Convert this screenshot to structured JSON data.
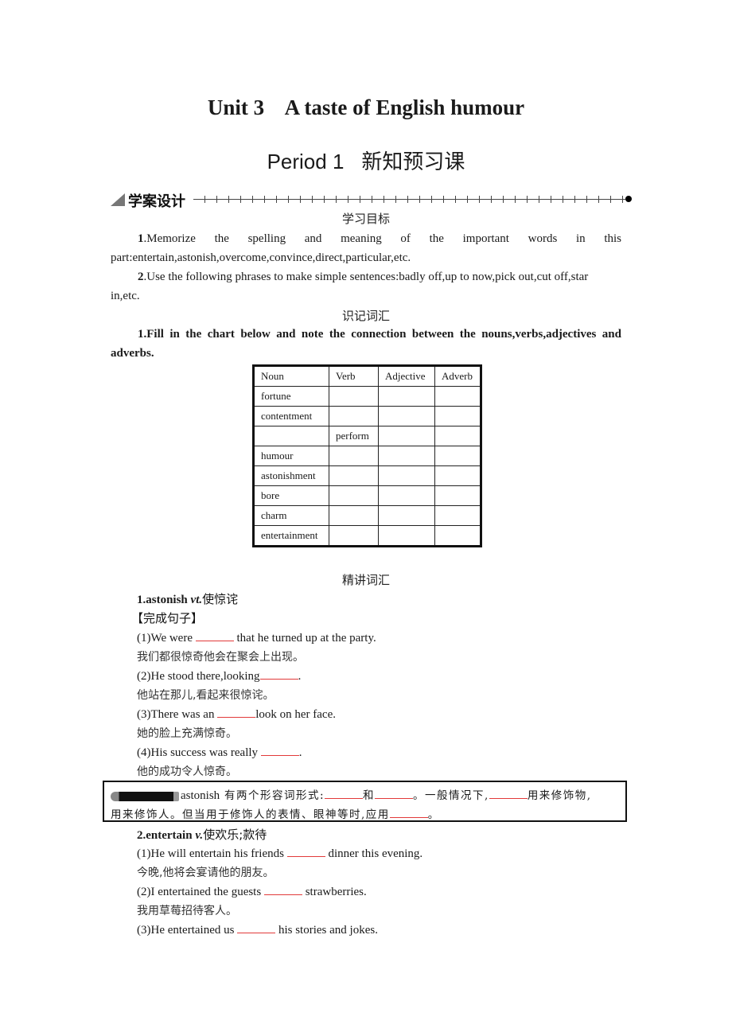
{
  "header": {
    "unit_title": "Unit 3    A taste of English humour",
    "period_label": "Period 1",
    "period_cn": "新知预习课"
  },
  "section": {
    "label": "学案设计",
    "icon": "triangle-icon"
  },
  "objectives": {
    "heading": "学习目标",
    "items": [
      {
        "num": "1",
        "text": ".Memorize the spelling and meaning of the important words in this",
        "text2": "part:entertain,astonish,overcome,convince,direct,particular,etc."
      },
      {
        "num": "2",
        "text": ".Use the following phrases to make simple sentences:badly off,up to now,pick out,cut off,star",
        "text2": "in,etc."
      }
    ]
  },
  "vocab": {
    "heading": "识记词汇",
    "instruction_num": "1",
    "instruction": ".Fill in the chart below and note the connection between the nouns,verbs,adjectives and",
    "instruction2": "adverbs.",
    "table": {
      "headers": [
        "Noun",
        "Verb",
        "Adjective",
        "Adverb"
      ],
      "rows": [
        [
          "fortune",
          "",
          "",
          ""
        ],
        [
          "contentment",
          "",
          "",
          ""
        ],
        [
          "",
          "perform",
          "",
          ""
        ],
        [
          "humour",
          "",
          "",
          ""
        ],
        [
          "astonishment",
          "",
          "",
          ""
        ],
        [
          "bore",
          "",
          "",
          ""
        ],
        [
          "charm",
          "",
          "",
          ""
        ],
        [
          "entertainment",
          "",
          "",
          ""
        ]
      ]
    }
  },
  "explain": {
    "heading": "精讲词汇",
    "word1": {
      "title_num": "1.astonish ",
      "pos": "vt.",
      "meaning": "使惊诧",
      "task": "【完成句子】",
      "sentences": [
        {
          "pre": "(1)We were ",
          "post": " that he turned up at the party.",
          "cn": "我们都很惊奇他会在聚会上出现。"
        },
        {
          "pre": "(2)He stood there,looking",
          "post": ".",
          "cn": "他站在那儿,看起来很惊诧。"
        },
        {
          "pre": "(3)There was an ",
          "post": "look on her face.",
          "cn": "她的脸上充满惊奇。"
        },
        {
          "pre": "(4)His success was really ",
          "post": ".",
          "cn": "他的成功令人惊奇。"
        }
      ]
    },
    "note": {
      "icon": "summary-badge-icon",
      "line1_word": "astonish",
      "line1_a": " 有两个形容词形式:",
      "line1_b": "和",
      "line1_c": "。一般情况下,",
      "line1_d": "用来修饰物,",
      "line2_a": "用来修饰人。但当用于修饰人的表情、眼神等时,应用",
      "line2_b": "。"
    },
    "word2": {
      "title_num": "2",
      "title_word": ".entertain ",
      "pos": "v.",
      "meaning": "使欢乐;款待",
      "sentences": [
        {
          "pre": "(1)He will entertain his friends ",
          "post": " dinner this evening.",
          "cn": "今晚,他将会宴请他的朋友。"
        },
        {
          "pre": "(2)I entertained the guests ",
          "post": " strawberries.",
          "cn": "我用草莓招待客人。"
        },
        {
          "pre": "(3)He entertained us ",
          "post": " his stories and jokes.",
          "cn": ""
        }
      ]
    }
  },
  "colors": {
    "blank_underline": "#e23a3a",
    "text": "#1a1a1a"
  }
}
